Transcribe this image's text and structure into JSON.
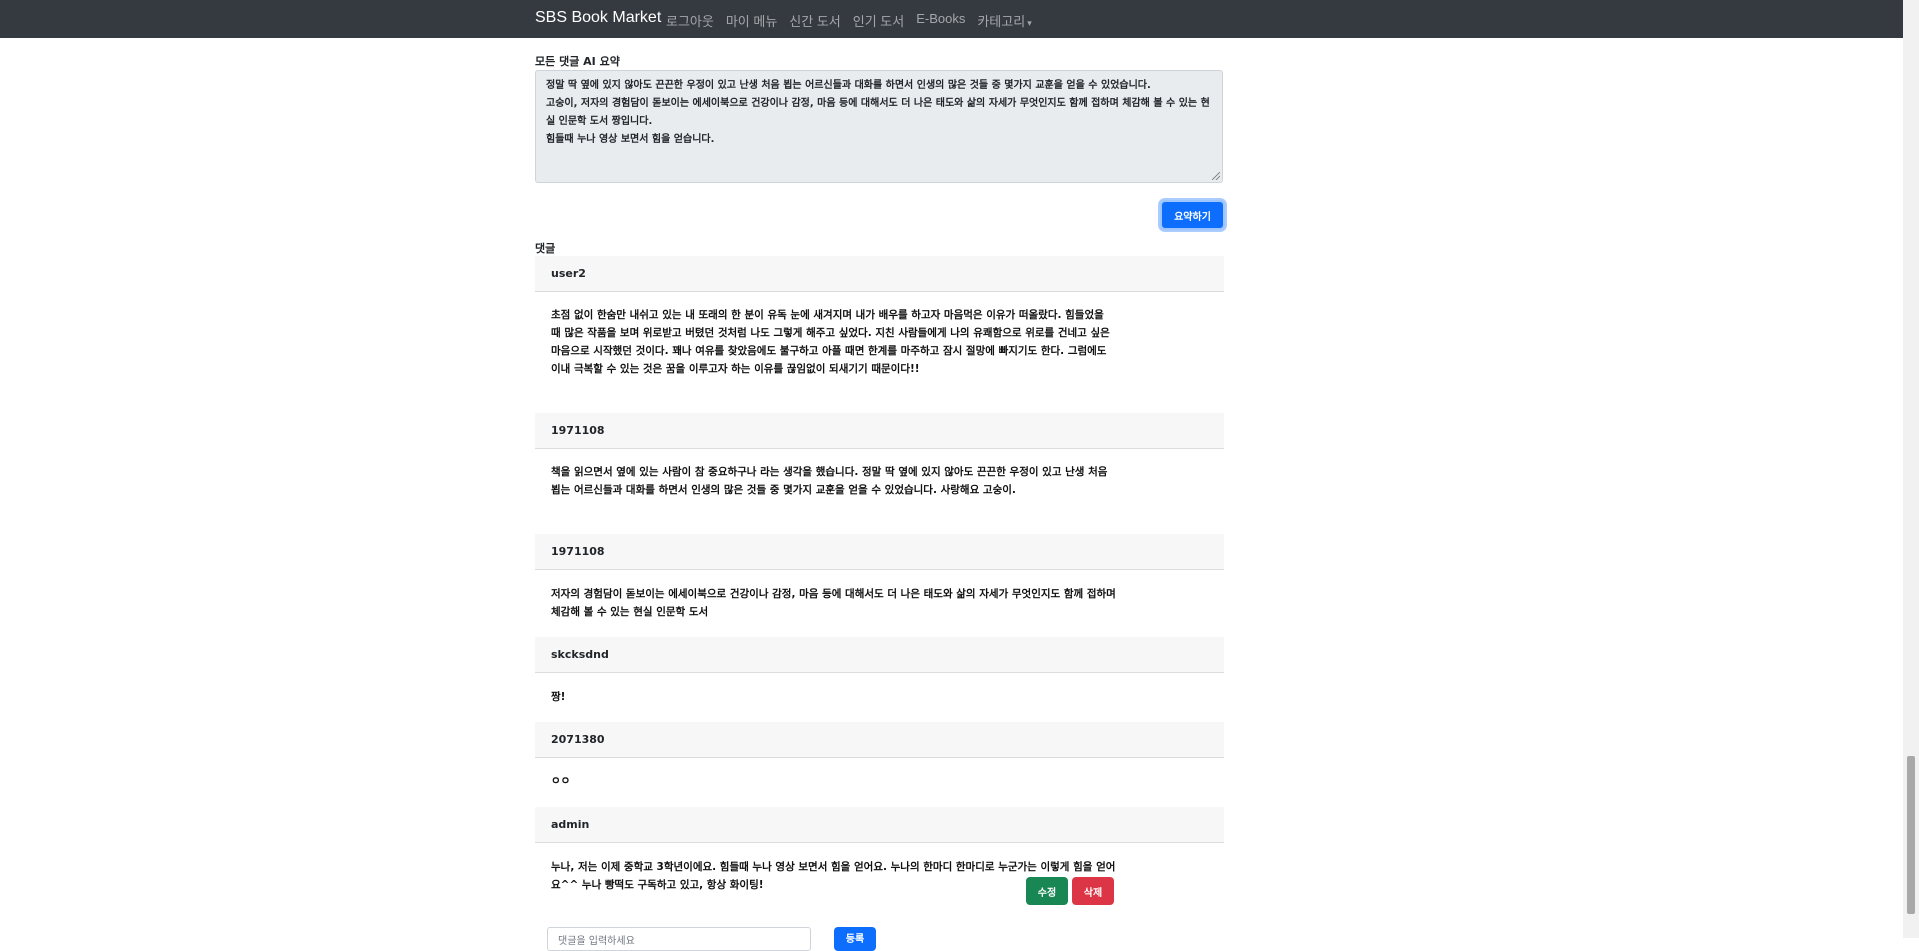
{
  "navbar": {
    "brand": "SBS Book Market",
    "links": [
      "로그아웃",
      "마이 메뉴",
      "신간 도서",
      "인기 도서",
      "E-Books",
      "카테고리"
    ]
  },
  "summary": {
    "label": "모든 댓글 AI 요약",
    "text": "정말 딱 옆에 있지 않아도 끈끈한 우정이 있고 난생 처음 뵙는 어르신들과 대화를 하면서 인생의 많은 것들 중 몇가지 교훈을 얻을 수 있었습니다.\n고숭이, 저자의 경험담이 돋보이는 에세이북으로 건강이나 감정, 마음 등에 대해서도 더 나은 태도와 삶의 자세가 무엇인지도 함께 접하며 체감해 볼 수 있는 현실 인문학 도서 짱입니다.\n힘들때 누나 영상 보면서 힘을 얻습니다.",
    "button": "요약하기"
  },
  "comments_label": "댓글",
  "comments": [
    {
      "user": "user2",
      "text": "초점 없이 한숨만 내쉬고 있는 내 또래의 한 분이 유독 눈에 새겨지며 내가 배우를 하고자 마음먹은 이유가 떠올랐다. 힘들었을 때 많은 작품을 보며 위로받고 버텼던 것처럼 나도 그렇게 해주고 싶었다. 지친 사람들에게 나의 유쾌함으로 위로를 건네고 싶은 마음으로 시작했던 것이다. 꽤나 여유를 찾았음에도 불구하고 아플 때면 한계를 마주하고 잠시 절망에 빠지기도 한다. 그럼에도 이내 극복할 수 있는 것은 꿈을 이루고자 하는 이유를 끊임없이 되새기기 때문이다!!"
    },
    {
      "user": "1971108",
      "text": "책을 읽으면서 옆에 있는 사람이 참 중요하구나 라는 생각을 했습니다. 정말 딱 옆에 있지 않아도 끈끈한 우정이 있고 난생 처음 뵙는 어르신들과 대화를 하면서 인생의 많은 것들 중 몇가지 교훈을 얻을 수 있었습니다. 사랑해요 고숭이."
    },
    {
      "user": "1971108",
      "text": "저자의 경험담이 돋보이는 에세이북으로 건강이나 감정, 마음 등에 대해서도 더 나은 태도와 삶의 자세가 무엇인지도 함께 접하며 체감해 볼 수 있는 현실 인문학 도서"
    },
    {
      "user": "skcksdnd",
      "text": "짱!"
    },
    {
      "user": "2071380",
      "text": "ㅇㅇ"
    },
    {
      "user": "admin",
      "text": "누나, 저는 이제 중학교 3학년이에요. 힘들때 누나 영상 보면서 힘을 얻어요. 누나의 한마디 한마디로 누군가는 이렇게 힘을 얻어요^^ 누나 빵떡도 구독하고 있고, 항상 화이팅!",
      "edit": "수정",
      "delete": "삭제"
    }
  ],
  "new_comment": {
    "placeholder": "댓글을 입력하세요",
    "submit": "등록"
  }
}
